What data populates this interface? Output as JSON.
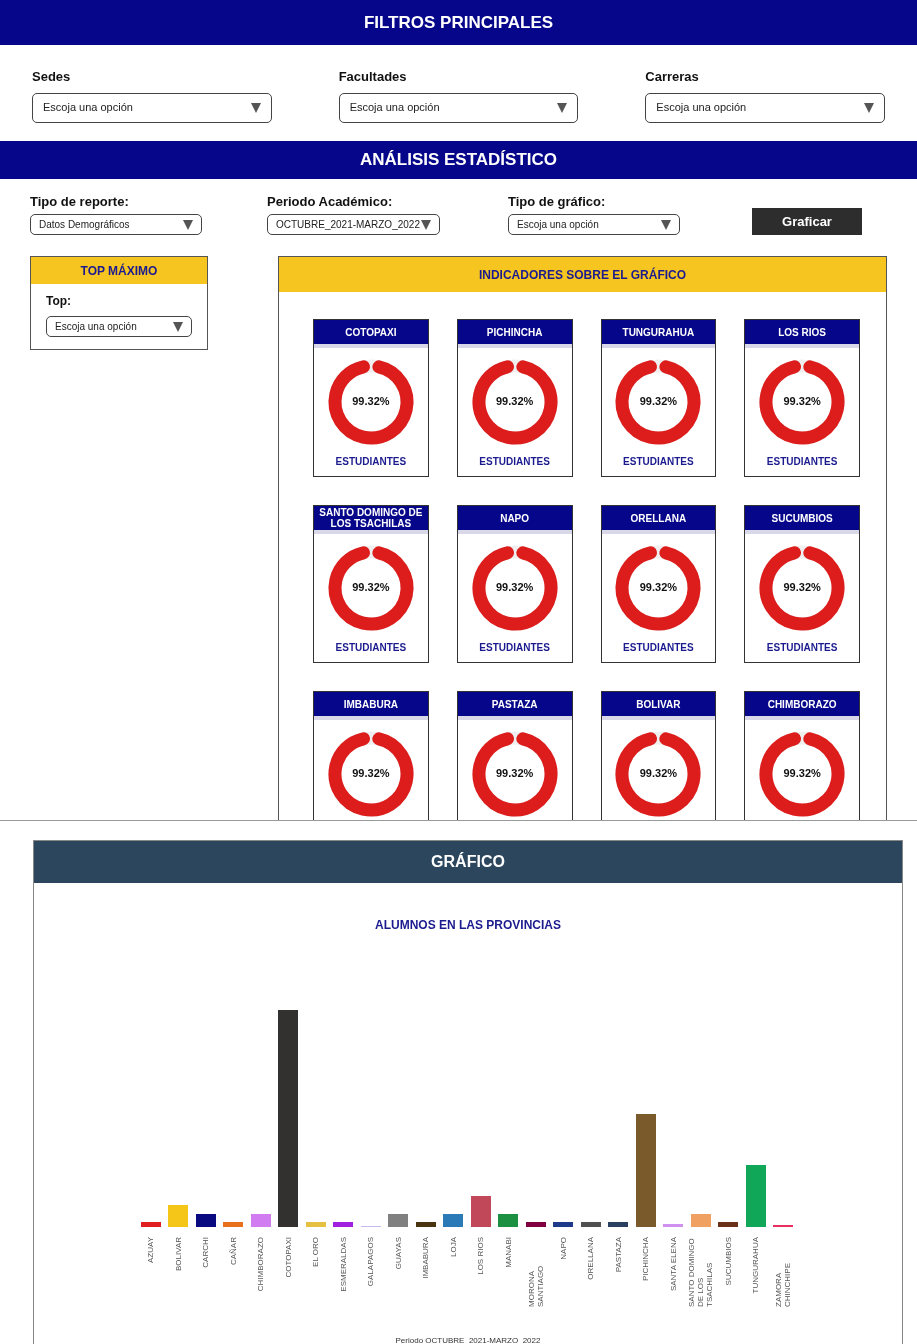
{
  "filters_header": {
    "title": "FILTROS PRINCIPALES"
  },
  "filters": [
    {
      "label": "Sedes",
      "value": "Escoja una opción"
    },
    {
      "label": "Facultades",
      "value": "Escoja una opción"
    },
    {
      "label": "Carreras",
      "value": "Escoja una opción"
    }
  ],
  "analysis_header": {
    "title": "ANÁLISIS ESTADÍSTICO"
  },
  "report_controls": [
    {
      "label": "Tipo de reporte:",
      "value": "Datos Demográficos"
    },
    {
      "label": "Periodo Académico:",
      "value": "OCTUBRE_2021-MARZO_2022"
    },
    {
      "label": "Tipo de gráfico:",
      "value": "Escoja una opción"
    }
  ],
  "plot_button": "Graficar",
  "top_panel": {
    "title": "TOP MÁXIMO",
    "label": "Top:",
    "value": "Escoja una opción"
  },
  "indicators": {
    "title": "INDICADORES SOBRE EL GRÁFICO",
    "cards": [
      {
        "name": "COTOPAXI",
        "value": "99.32%",
        "level": 0.93,
        "caption": "ESTUDIANTES"
      },
      {
        "name": "PICHINCHA",
        "value": "99.32%",
        "level": 0.93,
        "caption": "ESTUDIANTES"
      },
      {
        "name": "TUNGURAHUA",
        "value": "99.32%",
        "level": 0.93,
        "caption": "ESTUDIANTES"
      },
      {
        "name": "LOS RIOS",
        "value": "99.32%",
        "level": 0.93,
        "caption": "ESTUDIANTES"
      },
      {
        "name": "SANTO DOMINGO DE LOS TSACHILAS",
        "value": "99.32%",
        "level": 0.93,
        "caption": "ESTUDIANTES"
      },
      {
        "name": "NAPO",
        "value": "99.32%",
        "level": 0.93,
        "caption": "ESTUDIANTES"
      },
      {
        "name": "ORELLANA",
        "value": "99.32%",
        "level": 0.93,
        "caption": "ESTUDIANTES"
      },
      {
        "name": "SUCUMBIOS",
        "value": "99.32%",
        "level": 0.93,
        "caption": "ESTUDIANTES"
      },
      {
        "name": "IMBABURA",
        "value": "99.32%",
        "level": 0.93
      },
      {
        "name": "PASTAZA",
        "value": "99.32%",
        "level": 0.93
      },
      {
        "name": "BOLIVAR",
        "value": "99.32%",
        "level": 0.93
      },
      {
        "name": "CHIMBORAZO",
        "value": "99.32%",
        "level": 0.93
      }
    ]
  },
  "chart_section": {
    "title": "GRÁFICO",
    "chart_title": "ALUMNOS EN LAS PROVINCIAS",
    "axis_labels": [
      "AZUAY",
      "BOLIVAR",
      "CARCHI",
      "CAÑAR",
      "CHIMBORAZO",
      "COTOPAXI",
      "EL ORO",
      "ESMERALDAS",
      "GALAPAGOS",
      "GUAYAS",
      "IMBABURA",
      "LOJA",
      "LOS RIOS",
      "MANABI",
      "MORONA SANTIAGO",
      "NAPO",
      "ORELLANA",
      "PASTAZA",
      "PICHINCHA",
      "SANTA ELENA",
      "SANTO DOMINGO DE LOS TSACHILAS",
      "SUCUMBIOS",
      "TUNGURAHUA",
      "ZAMORA CHINCHIPE"
    ],
    "footer": "Periodo OCTUBRE_2021-MARZO_2022"
  }
}
